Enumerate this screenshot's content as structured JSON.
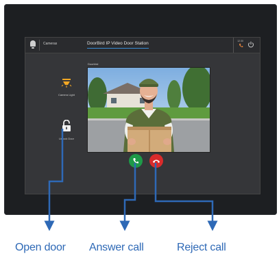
{
  "topbar": {
    "section_label": "Cameras",
    "station_title": "DoorBird IP Video Door Station",
    "right_mini_text": "12:30"
  },
  "sidebar": {
    "light_label": "Camera Light",
    "unlock_label": "Unlock Door"
  },
  "video": {
    "label": "Doorbird"
  },
  "callouts": {
    "open_door": "Open door",
    "answer_call": "Answer call",
    "reject_call": "Reject call"
  },
  "colors": {
    "accent": "#3a8dd6",
    "answer": "#1e9a48",
    "reject": "#d92b2b",
    "callout": "#2e69b6"
  },
  "icons": [
    "bell-icon",
    "phone-icon",
    "power-icon",
    "lamp-icon",
    "unlock-icon",
    "answer-phone-icon",
    "hangup-phone-icon",
    "arrow-icon"
  ]
}
